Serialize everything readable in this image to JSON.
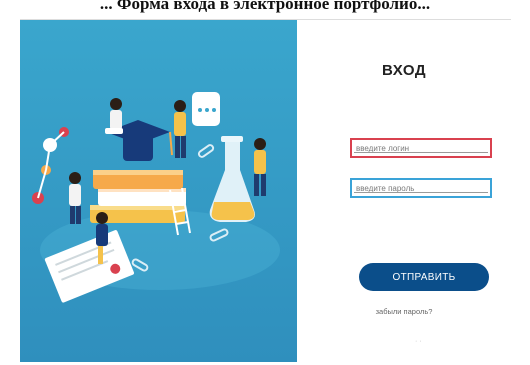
{
  "caption": "... Форма входа в электронное портфолио...",
  "login_form": {
    "title": "ВХОД",
    "login_placeholder": "введите логин",
    "password_placeholder": "введите пароль",
    "submit_label": "ОТПРАВИТЬ",
    "forgot_link": "забыли пароль?",
    "footer_marks": "·  ·"
  },
  "illustration": {
    "subject": "education-illustration",
    "background_color": "#3aa6cd"
  },
  "colors": {
    "login_border": "#d9414f",
    "password_border": "#3aa3d8",
    "button": "#0b4e8a"
  }
}
